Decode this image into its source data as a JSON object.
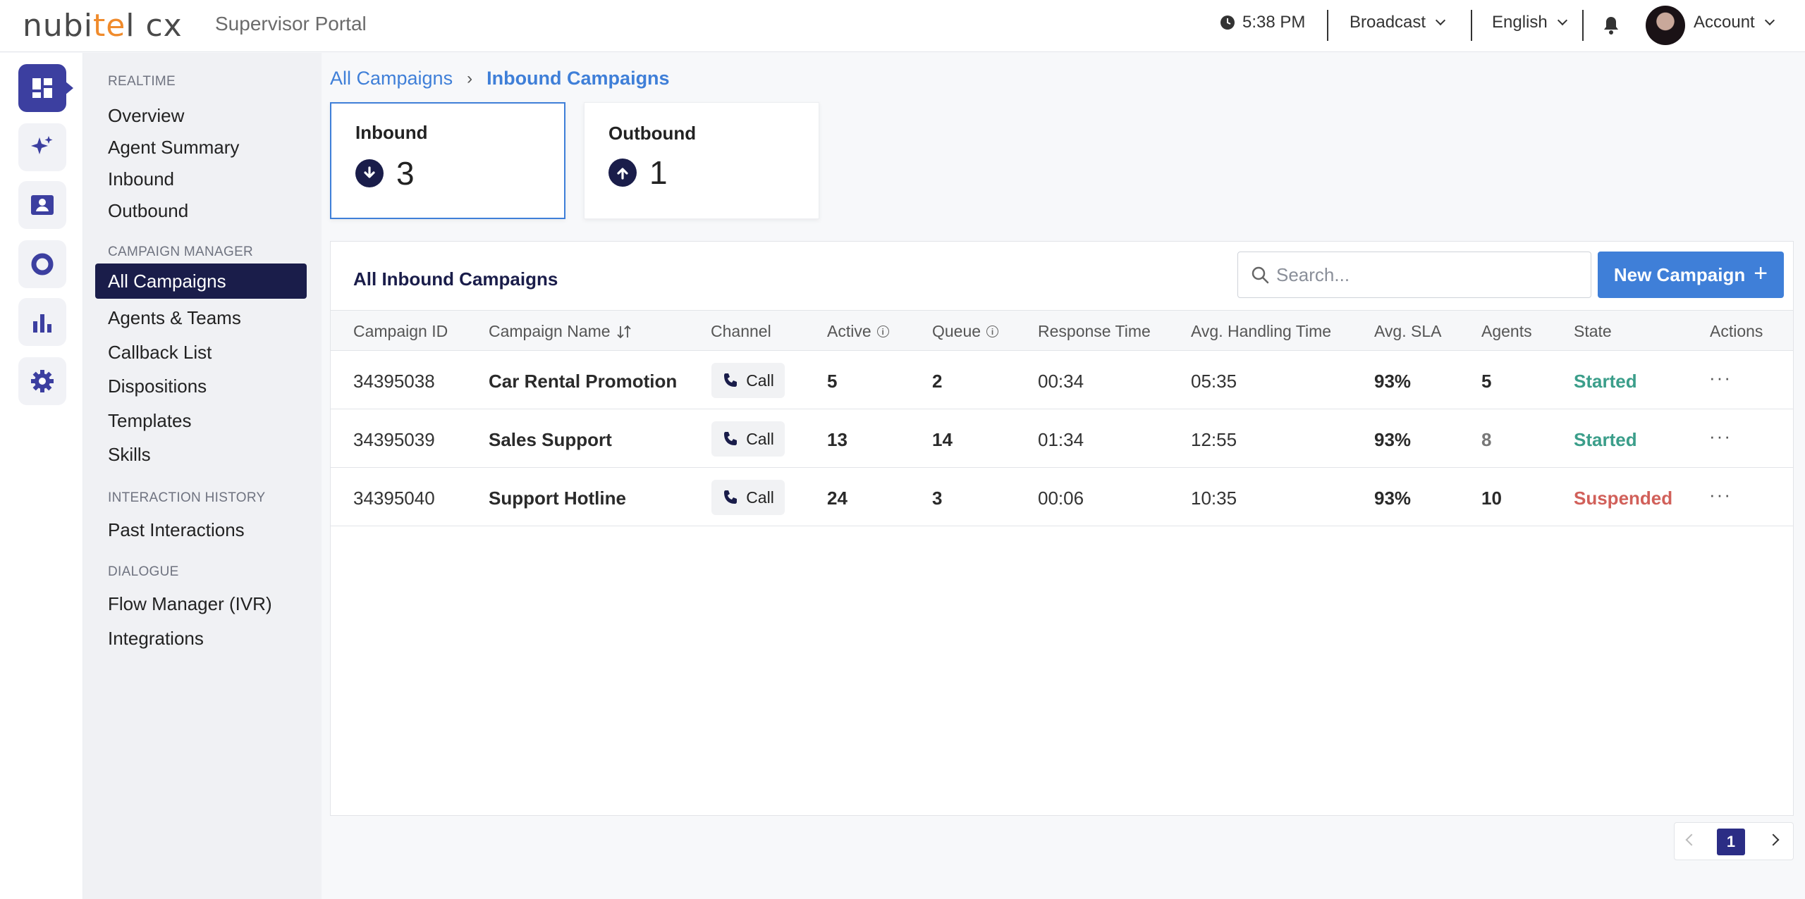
{
  "header": {
    "logo": "nubitel cx",
    "portal_title": "Supervisor Portal",
    "time": "5:38 PM",
    "broadcast": "Broadcast",
    "language": "English",
    "account": "Account"
  },
  "rail": {
    "icons": [
      "dashboard-icon",
      "sparkle-icon",
      "contact-card-icon",
      "ring-chart-icon",
      "bar-chart-icon",
      "gear-icon"
    ]
  },
  "nav": {
    "sections": [
      {
        "title": "REALTIME",
        "items": [
          "Overview",
          "Agent Summary",
          "Inbound",
          "Outbound"
        ]
      },
      {
        "title": "CAMPAIGN MANAGER",
        "items": [
          "All Campaigns",
          "Agents & Teams",
          "Callback List",
          "Dispositions",
          "Templates",
          "Skills"
        ]
      },
      {
        "title": "INTERACTION HISTORY",
        "items": [
          "Past Interactions"
        ]
      },
      {
        "title": "DIALOGUE",
        "items": [
          "Flow Manager (IVR)",
          "Integrations"
        ]
      }
    ],
    "active": "All Campaigns"
  },
  "breadcrumb": {
    "parent": "All Campaigns",
    "separator": "›",
    "current": "Inbound Campaigns"
  },
  "stats": {
    "inbound": {
      "label": "Inbound",
      "value": "3"
    },
    "outbound": {
      "label": "Outbound",
      "value": "1"
    }
  },
  "panel": {
    "title": "All Inbound Campaigns",
    "search_placeholder": "Search...",
    "new_button": "New Campaign",
    "new_button_icon": "+",
    "columns": {
      "id": "Campaign ID",
      "name": "Campaign Name",
      "channel": "Channel",
      "active": "Active",
      "queue": "Queue",
      "response": "Response Time",
      "aht": "Avg. Handling Time",
      "sla": "Avg. SLA",
      "agents": "Agents",
      "state": "State",
      "actions": "Actions"
    },
    "rows": [
      {
        "id": "34395038",
        "name": "Car Rental Promotion",
        "channel": "Call",
        "active": "5",
        "queue": "2",
        "response": "00:34",
        "aht": "05:35",
        "sla": "93%",
        "agents": "5",
        "state": "Started",
        "actions": "···"
      },
      {
        "id": "34395039",
        "name": "Sales Support",
        "channel": "Call",
        "active": "13",
        "queue": "14",
        "response": "01:34",
        "aht": "12:55",
        "sla": "93%",
        "agents": "8",
        "state": "Started",
        "actions": "···"
      },
      {
        "id": "34395040",
        "name": "Support Hotline",
        "channel": "Call",
        "active": "24",
        "queue": "3",
        "response": "00:06",
        "aht": "10:35",
        "sla": "93%",
        "agents": "10",
        "state": "Suspended",
        "actions": "···"
      }
    ]
  },
  "pagination": {
    "current_page": "1"
  },
  "colors": {
    "brand_navy": "#1a1d4a",
    "accent_blue": "#3f7fd8",
    "started": "#3b9e8a",
    "suspended": "#d1605a",
    "logo_orange": "#f08b2c"
  }
}
